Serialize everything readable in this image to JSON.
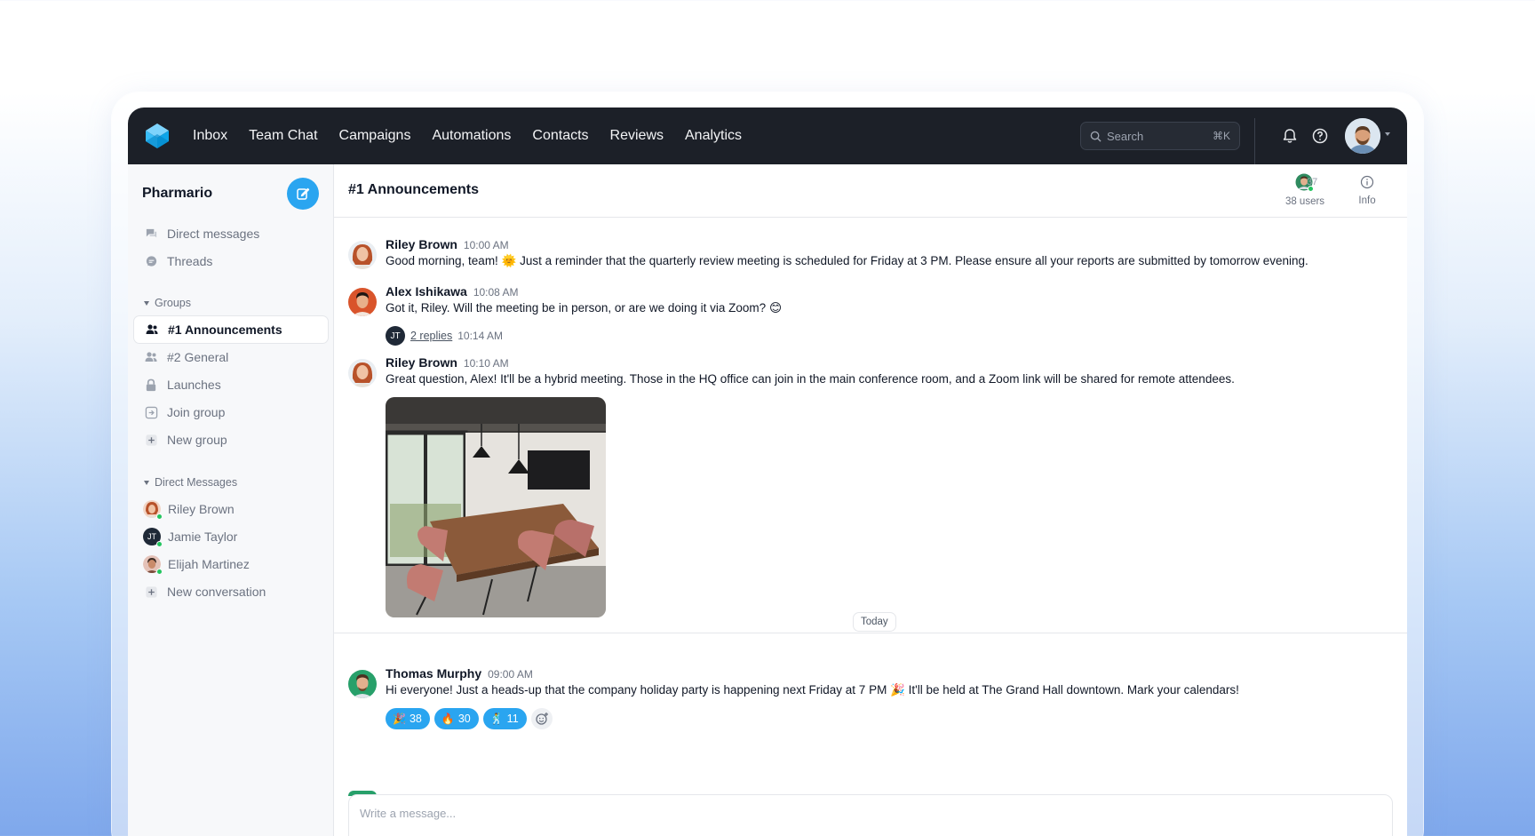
{
  "nav": {
    "items": [
      "Inbox",
      "Team Chat",
      "Campaigns",
      "Automations",
      "Contacts",
      "Reviews",
      "Analytics"
    ]
  },
  "search": {
    "placeholder": "Search",
    "shortcut": "⌘K"
  },
  "colors": {
    "accent": "#2aa5f0",
    "topbar": "#1c2028",
    "online": "#22c55e"
  },
  "sidebar": {
    "workspace": "Pharmario",
    "top_items": [
      {
        "label": "Direct messages",
        "icon": "chat-bubbles-icon"
      },
      {
        "label": "Threads",
        "icon": "thread-icon"
      }
    ],
    "groups_heading": "Groups",
    "groups": [
      {
        "label": "#1 Announcements",
        "icon": "users-icon",
        "active": true
      },
      {
        "label": "#2 General",
        "icon": "users-icon"
      },
      {
        "label": "Launches",
        "icon": "lock-icon"
      },
      {
        "label": "Join group",
        "icon": "join-icon"
      },
      {
        "label": "New group",
        "icon": "plus-icon"
      }
    ],
    "dm_heading": "Direct Messages",
    "dms": [
      {
        "label": "Riley Brown"
      },
      {
        "label": "Jamie Taylor",
        "initials": "JT"
      },
      {
        "label": "Elijah Martinez"
      },
      {
        "label": "New conversation",
        "icon": "plus-icon"
      }
    ]
  },
  "channel": {
    "title": "#1 Announcements",
    "member_count": "37",
    "users_label": "38 users",
    "info_label": "Info"
  },
  "messages": [
    {
      "name": "Riley Brown",
      "time": "10:00 AM",
      "text": "Good morning, team! 🌞 Just a reminder that the quarterly review meeting is scheduled for Friday at 3 PM. Please ensure all your reports are submitted by tomorrow evening."
    },
    {
      "name": "Alex Ishikawa",
      "time": "10:08 AM",
      "text": "Got it, Riley. Will the meeting be in person, or are we doing it via Zoom? 😊",
      "replies": {
        "initials": "JT",
        "label": "2 replies",
        "time": "10:14 AM"
      }
    },
    {
      "name": "Riley Brown",
      "time": "10:10 AM",
      "text": "Great question, Alex! It'll be a hybrid meeting. Those in the HQ office can join in the main conference room, and a Zoom link will be shared for remote attendees."
    },
    {
      "name": "Thomas Murphy",
      "time": "09:00 AM",
      "text": "Hi everyone! Just a heads-up that the company holiday party is happening next Friday at 7 PM 🎉 It'll be held at The Grand Hall downtown. Mark your calendars!",
      "reactions": [
        {
          "emoji": "🎉",
          "count": "38"
        },
        {
          "emoji": "🔥",
          "count": "30"
        },
        {
          "emoji": "🕺",
          "count": "11"
        }
      ]
    }
  ],
  "divider": {
    "label": "Today"
  },
  "composer": {
    "placeholder": "Write a message..."
  }
}
